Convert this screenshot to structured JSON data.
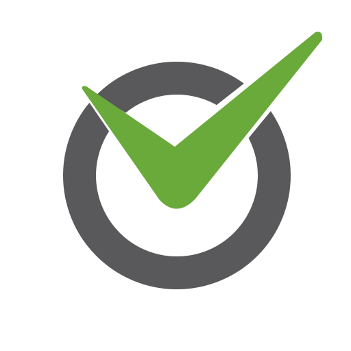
{
  "logo": {
    "name": "checkmark-circle-logo",
    "colors": {
      "ring": "#59585a",
      "check": "#6aaa3a",
      "background": "#ffffff"
    }
  }
}
